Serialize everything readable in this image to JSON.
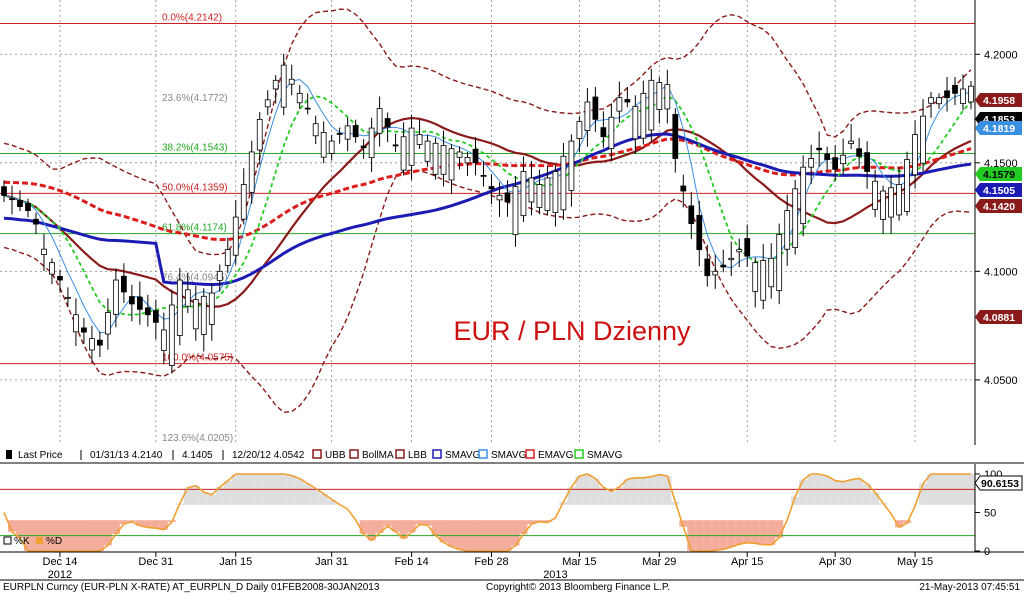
{
  "chart_data": {
    "type": "candlestick",
    "title": "EUR / PLN Dzienny",
    "colors": {
      "title": "#cc1010",
      "bollinger_band": "#8b1a1a",
      "bollinger_ma": "#8b1a1a",
      "smavg_long": "#1c1cb4",
      "smavg_short": "#3a8fe0",
      "emavg": "#dd1c1c",
      "smavg_green": "#22cc22",
      "fib_red": "#cc2020",
      "fib_green": "#22aa22",
      "osc_line": "#f0a030",
      "osc_fill_pos": "#f08a70",
      "osc_fill_neg": "#d0d0d0"
    },
    "y_axis": {
      "min": 4.02,
      "max": 4.225,
      "ticks": [
        "4.2000",
        "4.1500",
        "4.1000",
        "4.0500"
      ]
    },
    "x_axis": {
      "labels": [
        "Dec 14",
        "Dec 31",
        "Jan 15",
        "Jan 31",
        "Feb 14",
        "Feb 28",
        "Mar 15",
        "Mar 29",
        "Apr 15",
        "Apr 30",
        "May 15"
      ],
      "label_positions": [
        7,
        19,
        29,
        41,
        51,
        61,
        72,
        82,
        93,
        104,
        114
      ],
      "year_labels": [
        {
          "text": "2012",
          "pos": 7
        },
        {
          "text": "2013",
          "pos": 69
        }
      ],
      "session_count": 122
    },
    "fibonacci": [
      {
        "label": "0.0%(4.2142)",
        "value": 4.2142,
        "color": "red"
      },
      {
        "label": "23.6%(4.1772)",
        "value": 4.1772,
        "color": "none"
      },
      {
        "label": "38.2%(4.1543)",
        "value": 4.1543,
        "color": "green"
      },
      {
        "label": "50.0%(4.1359)",
        "value": 4.1359,
        "color": "red"
      },
      {
        "label": "61.8%(4.1174)",
        "value": 4.1174,
        "color": "green"
      },
      {
        "label": "76.4%(4.0945)",
        "value": 4.0945,
        "color": "none"
      },
      {
        "label": "100.0%(4.0575)",
        "value": 4.0575,
        "color": "red"
      },
      {
        "label": "123.6%(4.0205)",
        "value": 4.0205,
        "color": "none"
      }
    ],
    "last_values": [
      {
        "label": "4.1958",
        "value": 4.1958,
        "series": "UBB",
        "bg": "#8b1a1a",
        "fg": "#ffffff"
      },
      {
        "label": "4.1853",
        "value": 4.1853,
        "series": "Last Price",
        "bg": "#000000",
        "fg": "#ffffff"
      },
      {
        "label": "4.1819",
        "value": 4.1819,
        "series": "SMAVG short",
        "bg": "#3a8fe0",
        "fg": "#ffffff"
      },
      {
        "label": "4.1579",
        "value": 4.1579,
        "series": "SMAVG green",
        "bg": "#22cc22",
        "fg": "#000000"
      },
      {
        "label": "4.1505",
        "value": 4.1505,
        "series": "SMAVG long",
        "bg": "#1c1cb4",
        "fg": "#ffffff"
      },
      {
        "label": "4.1420",
        "value": 4.142,
        "series": "BollMA",
        "bg": "#8b1a1a",
        "fg": "#ffffff"
      },
      {
        "label": "4.0881",
        "value": 4.0881,
        "series": "LBB",
        "bg": "#8b1a1a",
        "fg": "#ffffff"
      }
    ],
    "legend": [
      {
        "label": "Last Price",
        "type": "candle"
      },
      {
        "label": "01/31/13 4.2140",
        "type": "high"
      },
      {
        "label": "4.1405",
        "type": "avg"
      },
      {
        "label": "12/20/12 4.0542",
        "type": "low"
      },
      {
        "label": "UBB",
        "type": "ubb"
      },
      {
        "label": "BollMA",
        "type": "bollma"
      },
      {
        "label": "LBB",
        "type": "lbb"
      },
      {
        "label": "SMAVG",
        "type": "sma-long"
      },
      {
        "label": "SMAVG",
        "type": "sma-short"
      },
      {
        "label": "EMAVG",
        "type": "ema"
      },
      {
        "label": "SMAVG",
        "type": "sma-green"
      }
    ],
    "anchors": [
      [
        0,
        4.135
      ],
      [
        3,
        4.128
      ],
      [
        6,
        4.104
      ],
      [
        8,
        4.088
      ],
      [
        10,
        4.072
      ],
      [
        12,
        4.066
      ],
      [
        14,
        4.096
      ],
      [
        16,
        4.085
      ],
      [
        18,
        4.08
      ],
      [
        20,
        4.073
      ],
      [
        22,
        4.096
      ],
      [
        24,
        4.087
      ],
      [
        26,
        4.09
      ],
      [
        28,
        4.11
      ],
      [
        30,
        4.14
      ],
      [
        32,
        4.17
      ],
      [
        34,
        4.188
      ],
      [
        35,
        4.195
      ],
      [
        37,
        4.182
      ],
      [
        39,
        4.168
      ],
      [
        41,
        4.16
      ],
      [
        43,
        4.167
      ],
      [
        45,
        4.157
      ],
      [
        47,
        4.175
      ],
      [
        49,
        4.158
      ],
      [
        51,
        4.166
      ],
      [
        53,
        4.16
      ],
      [
        55,
        4.158
      ],
      [
        57,
        4.155
      ],
      [
        59,
        4.15
      ],
      [
        61,
        4.138
      ],
      [
        63,
        4.132
      ],
      [
        65,
        4.146
      ],
      [
        67,
        4.14
      ],
      [
        69,
        4.146
      ],
      [
        71,
        4.16
      ],
      [
        73,
        4.178
      ],
      [
        75,
        4.162
      ],
      [
        77,
        4.18
      ],
      [
        79,
        4.176
      ],
      [
        81,
        4.188
      ],
      [
        83,
        4.186
      ],
      [
        84,
        4.152
      ],
      [
        86,
        4.122
      ],
      [
        88,
        4.098
      ],
      [
        90,
        4.102
      ],
      [
        92,
        4.11
      ],
      [
        94,
        4.104
      ],
      [
        96,
        4.106
      ],
      [
        98,
        4.128
      ],
      [
        100,
        4.148
      ],
      [
        102,
        4.156
      ],
      [
        104,
        4.147
      ],
      [
        106,
        4.16
      ],
      [
        108,
        4.146
      ],
      [
        110,
        4.137
      ],
      [
        112,
        4.14
      ],
      [
        114,
        4.163
      ],
      [
        116,
        4.18
      ],
      [
        118,
        4.18
      ],
      [
        120,
        4.184
      ],
      [
        121,
        4.1853
      ]
    ],
    "oscillator": {
      "name": "%K",
      "name_d": "%D",
      "last": "90.6153",
      "ticks": [
        "100",
        "50",
        "0"
      ],
      "levels": [
        80,
        20
      ]
    }
  },
  "footer": {
    "left": "EURPLN Curncy (EUR-PLN X-RATE) AT_EURPLN_D  Daily 01FEB2008-30JAN2013",
    "center": "Copyright© 2013 Bloomberg Finance L.P.",
    "right": "21-May-2013 07:45:51"
  }
}
